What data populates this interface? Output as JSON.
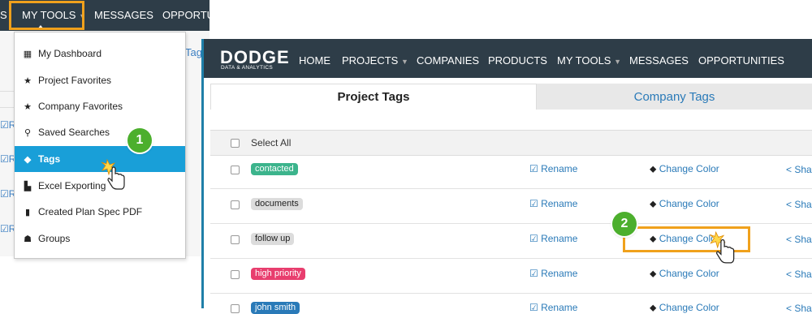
{
  "left_nav": {
    "items": [
      {
        "label": "S"
      },
      {
        "label": "MY TOOLS"
      },
      {
        "label": "MESSAGES"
      },
      {
        "label": "OPPORTU"
      }
    ],
    "partial_right_label": "Tag",
    "partial_left_labels": [
      "Re",
      "Re",
      "Re",
      "Re"
    ]
  },
  "dropdown": {
    "items": [
      {
        "label": "My Dashboard",
        "icon": "grid-icon"
      },
      {
        "label": "Project Favorites",
        "icon": "star-icon"
      },
      {
        "label": "Company Favorites",
        "icon": "star-icon"
      },
      {
        "label": "Saved Searches",
        "icon": "search-icon"
      },
      {
        "label": "Tags",
        "icon": "tag-icon",
        "active": true
      },
      {
        "label": "Excel Exporting",
        "icon": "export-icon"
      },
      {
        "label": "Created Plan Spec PDF",
        "icon": "file-icon"
      },
      {
        "label": "Groups",
        "icon": "groups-icon"
      }
    ]
  },
  "steps": {
    "one": "1",
    "two": "2"
  },
  "logo": {
    "name": "DODGE",
    "tagline": "DATA & ANALYTICS"
  },
  "nav": {
    "items": [
      {
        "label": "HOME"
      },
      {
        "label": "PROJECTS"
      },
      {
        "label": "COMPANIES"
      },
      {
        "label": "PRODUCTS"
      },
      {
        "label": "MY TOOLS"
      },
      {
        "label": "MESSAGES"
      },
      {
        "label": "OPPORTUNITIES"
      }
    ]
  },
  "tabs": {
    "project": "Project Tags",
    "company": "Company Tags"
  },
  "select_all": "Select All",
  "actions": {
    "rename": "Rename",
    "change_color": "Change Color",
    "share": "Sha"
  },
  "tags": [
    {
      "label": "contacted",
      "color": "#3cb48c",
      "text_color": "#ffffff"
    },
    {
      "label": "documents",
      "color": "#dcdcdc",
      "text_color": "#222222"
    },
    {
      "label": "follow up",
      "color": "#dcdcdc",
      "text_color": "#222222"
    },
    {
      "label": "high priority",
      "color": "#e83e6e",
      "text_color": "#ffffff"
    },
    {
      "label": "john smith",
      "color": "#2a7ab8",
      "text_color": "#ffffff"
    }
  ],
  "colors": {
    "accent_orange": "#f0a11c",
    "nav_bg": "#2e3d48",
    "active_blue": "#199fd8",
    "badge_green": "#4caf2d"
  }
}
